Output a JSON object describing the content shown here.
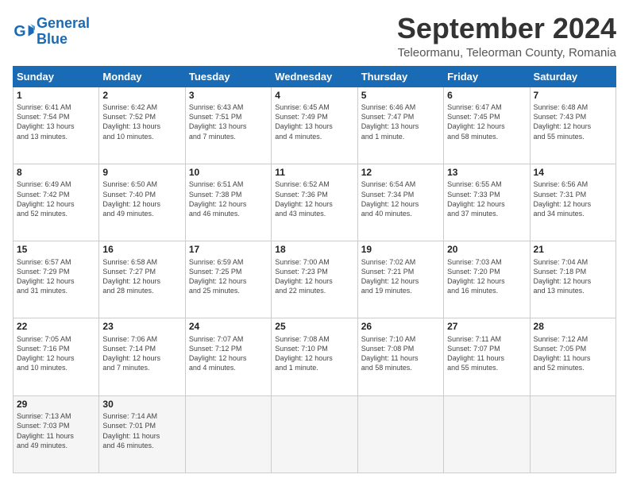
{
  "logo": {
    "line1": "General",
    "line2": "Blue"
  },
  "title": "September 2024",
  "location": "Teleormanu, Teleorman County, Romania",
  "days_header": [
    "Sunday",
    "Monday",
    "Tuesday",
    "Wednesday",
    "Thursday",
    "Friday",
    "Saturday"
  ],
  "weeks": [
    [
      {
        "num": "1",
        "info": "Sunrise: 6:41 AM\nSunset: 7:54 PM\nDaylight: 13 hours\nand 13 minutes."
      },
      {
        "num": "2",
        "info": "Sunrise: 6:42 AM\nSunset: 7:52 PM\nDaylight: 13 hours\nand 10 minutes."
      },
      {
        "num": "3",
        "info": "Sunrise: 6:43 AM\nSunset: 7:51 PM\nDaylight: 13 hours\nand 7 minutes."
      },
      {
        "num": "4",
        "info": "Sunrise: 6:45 AM\nSunset: 7:49 PM\nDaylight: 13 hours\nand 4 minutes."
      },
      {
        "num": "5",
        "info": "Sunrise: 6:46 AM\nSunset: 7:47 PM\nDaylight: 13 hours\nand 1 minute."
      },
      {
        "num": "6",
        "info": "Sunrise: 6:47 AM\nSunset: 7:45 PM\nDaylight: 12 hours\nand 58 minutes."
      },
      {
        "num": "7",
        "info": "Sunrise: 6:48 AM\nSunset: 7:43 PM\nDaylight: 12 hours\nand 55 minutes."
      }
    ],
    [
      {
        "num": "8",
        "info": "Sunrise: 6:49 AM\nSunset: 7:42 PM\nDaylight: 12 hours\nand 52 minutes."
      },
      {
        "num": "9",
        "info": "Sunrise: 6:50 AM\nSunset: 7:40 PM\nDaylight: 12 hours\nand 49 minutes."
      },
      {
        "num": "10",
        "info": "Sunrise: 6:51 AM\nSunset: 7:38 PM\nDaylight: 12 hours\nand 46 minutes."
      },
      {
        "num": "11",
        "info": "Sunrise: 6:52 AM\nSunset: 7:36 PM\nDaylight: 12 hours\nand 43 minutes."
      },
      {
        "num": "12",
        "info": "Sunrise: 6:54 AM\nSunset: 7:34 PM\nDaylight: 12 hours\nand 40 minutes."
      },
      {
        "num": "13",
        "info": "Sunrise: 6:55 AM\nSunset: 7:33 PM\nDaylight: 12 hours\nand 37 minutes."
      },
      {
        "num": "14",
        "info": "Sunrise: 6:56 AM\nSunset: 7:31 PM\nDaylight: 12 hours\nand 34 minutes."
      }
    ],
    [
      {
        "num": "15",
        "info": "Sunrise: 6:57 AM\nSunset: 7:29 PM\nDaylight: 12 hours\nand 31 minutes."
      },
      {
        "num": "16",
        "info": "Sunrise: 6:58 AM\nSunset: 7:27 PM\nDaylight: 12 hours\nand 28 minutes."
      },
      {
        "num": "17",
        "info": "Sunrise: 6:59 AM\nSunset: 7:25 PM\nDaylight: 12 hours\nand 25 minutes."
      },
      {
        "num": "18",
        "info": "Sunrise: 7:00 AM\nSunset: 7:23 PM\nDaylight: 12 hours\nand 22 minutes."
      },
      {
        "num": "19",
        "info": "Sunrise: 7:02 AM\nSunset: 7:21 PM\nDaylight: 12 hours\nand 19 minutes."
      },
      {
        "num": "20",
        "info": "Sunrise: 7:03 AM\nSunset: 7:20 PM\nDaylight: 12 hours\nand 16 minutes."
      },
      {
        "num": "21",
        "info": "Sunrise: 7:04 AM\nSunset: 7:18 PM\nDaylight: 12 hours\nand 13 minutes."
      }
    ],
    [
      {
        "num": "22",
        "info": "Sunrise: 7:05 AM\nSunset: 7:16 PM\nDaylight: 12 hours\nand 10 minutes."
      },
      {
        "num": "23",
        "info": "Sunrise: 7:06 AM\nSunset: 7:14 PM\nDaylight: 12 hours\nand 7 minutes."
      },
      {
        "num": "24",
        "info": "Sunrise: 7:07 AM\nSunset: 7:12 PM\nDaylight: 12 hours\nand 4 minutes."
      },
      {
        "num": "25",
        "info": "Sunrise: 7:08 AM\nSunset: 7:10 PM\nDaylight: 12 hours\nand 1 minute."
      },
      {
        "num": "26",
        "info": "Sunrise: 7:10 AM\nSunset: 7:08 PM\nDaylight: 11 hours\nand 58 minutes."
      },
      {
        "num": "27",
        "info": "Sunrise: 7:11 AM\nSunset: 7:07 PM\nDaylight: 11 hours\nand 55 minutes."
      },
      {
        "num": "28",
        "info": "Sunrise: 7:12 AM\nSunset: 7:05 PM\nDaylight: 11 hours\nand 52 minutes."
      }
    ],
    [
      {
        "num": "29",
        "info": "Sunrise: 7:13 AM\nSunset: 7:03 PM\nDaylight: 11 hours\nand 49 minutes."
      },
      {
        "num": "30",
        "info": "Sunrise: 7:14 AM\nSunset: 7:01 PM\nDaylight: 11 hours\nand 46 minutes."
      },
      {
        "num": "",
        "info": ""
      },
      {
        "num": "",
        "info": ""
      },
      {
        "num": "",
        "info": ""
      },
      {
        "num": "",
        "info": ""
      },
      {
        "num": "",
        "info": ""
      }
    ]
  ]
}
